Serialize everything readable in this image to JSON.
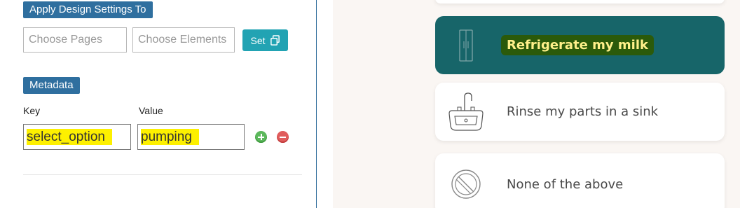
{
  "design": {
    "section_label": "Apply Design Settings To",
    "pages_placeholder": "Choose Pages",
    "elements_placeholder": "Choose Elements",
    "set_label": "Set"
  },
  "metadata": {
    "section_label": "Metadata",
    "key_label": "Key",
    "value_label": "Value",
    "key_value": "select_option",
    "value_value": "pumping"
  },
  "options": {
    "items": [
      {
        "label": "Refrigerate my milk",
        "icon": "refrigerator-icon",
        "selected": true
      },
      {
        "label": "Rinse my parts in a sink",
        "icon": "sink-icon",
        "selected": false
      },
      {
        "label": "None of the above",
        "icon": "prohibited-icon",
        "selected": false
      }
    ]
  },
  "colors": {
    "section_label_bg": "#2f6f9f",
    "set_button_bg": "#22a3b3",
    "highlight": "#fdf000",
    "selected_card_bg": "#176569",
    "selected_text": "#fff08a"
  }
}
